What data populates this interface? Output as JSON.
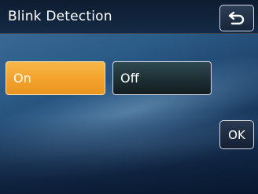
{
  "header": {
    "title": "Blink Detection",
    "back_icon": "back-arrow-icon"
  },
  "options": {
    "on_label": "On",
    "off_label": "Off",
    "selected": "On"
  },
  "actions": {
    "ok_label": "OK"
  },
  "colors": {
    "selected": "#f3a42e",
    "unselected": "#1d2f33",
    "button_border": "#cfd8e2",
    "title_bar": "#0e1c30"
  }
}
